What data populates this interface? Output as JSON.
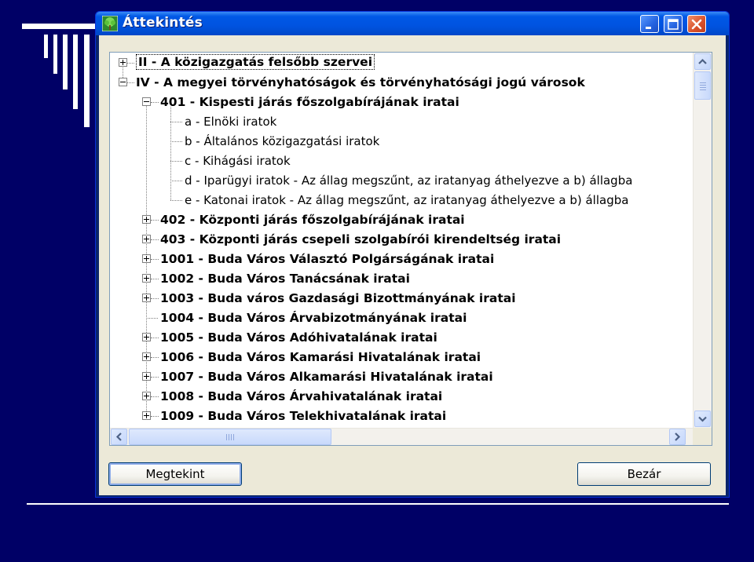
{
  "window": {
    "title": "Áttekintés"
  },
  "tree": {
    "items": [
      {
        "label": "II - A közigazgatás felsőbb szervei",
        "level": 0,
        "toggle": "plus",
        "bold": true,
        "selected": true
      },
      {
        "label": "IV - A megyei törvényhatóságok és törvényhatósági jogú városok",
        "level": 0,
        "toggle": "minus",
        "bold": true
      },
      {
        "label": "401 - Kispesti járás főszolgabírájának iratai",
        "level": 1,
        "toggle": "minus",
        "bold": true
      },
      {
        "label": "a - Elnöki iratok",
        "level": 2,
        "toggle": "none",
        "bold": false
      },
      {
        "label": "b - Általános közigazgatási iratok",
        "level": 2,
        "toggle": "none",
        "bold": false
      },
      {
        "label": "c - Kihágási iratok",
        "level": 2,
        "toggle": "none",
        "bold": false
      },
      {
        "label": "d - Iparügyi iratok - Az állag megszűnt, az iratanyag áthelyezve a b) állagba",
        "level": 2,
        "toggle": "none",
        "bold": false
      },
      {
        "label": "e - Katonai iratok - Az állag megszűnt, az iratanyag áthelyezve a b) állagba",
        "level": 2,
        "toggle": "none",
        "bold": false
      },
      {
        "label": "402 - Központi járás főszolgabírájának iratai",
        "level": 1,
        "toggle": "plus",
        "bold": true
      },
      {
        "label": "403 - Központi járás csepeli szolgabírói kirendeltség iratai",
        "level": 1,
        "toggle": "plus",
        "bold": true
      },
      {
        "label": "1001 - Buda Város Választó Polgárságának iratai",
        "level": 1,
        "toggle": "plus",
        "bold": true
      },
      {
        "label": "1002 - Buda Város Tanácsának iratai",
        "level": 1,
        "toggle": "plus",
        "bold": true
      },
      {
        "label": "1003 - Buda város Gazdasági Bizottmányának iratai",
        "level": 1,
        "toggle": "plus",
        "bold": true
      },
      {
        "label": "1004 - Buda Város Árvabizotmányának iratai",
        "level": 1,
        "toggle": "none",
        "bold": true
      },
      {
        "label": "1005 - Buda Város Adóhivatalának iratai",
        "level": 1,
        "toggle": "plus",
        "bold": true
      },
      {
        "label": "1006 - Buda Város Kamarási Hivatalának iratai",
        "level": 1,
        "toggle": "plus",
        "bold": true
      },
      {
        "label": "1007 - Buda Város Alkamarási Hivatalának iratai",
        "level": 1,
        "toggle": "plus",
        "bold": true
      },
      {
        "label": "1008 - Buda Város Árvahivatalának iratai",
        "level": 1,
        "toggle": "plus",
        "bold": true
      },
      {
        "label": "1009 - Buda Város Telekhivatalának iratai",
        "level": 1,
        "toggle": "plus",
        "bold": true
      }
    ]
  },
  "buttons": {
    "view_label": "Megtekint",
    "close_label": "Bezár"
  },
  "colors": {
    "slide_background": "#000066",
    "titlebar_blue": "#0058e6",
    "close_red": "#d8502a",
    "dialog_face": "#ece9d8"
  }
}
